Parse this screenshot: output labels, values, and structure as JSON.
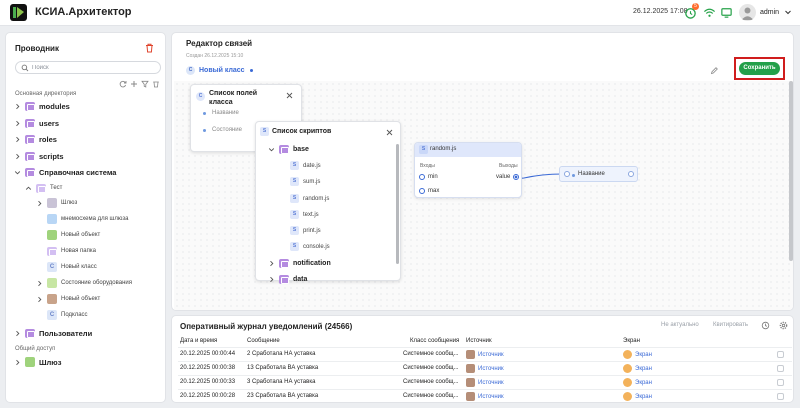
{
  "header": {
    "app_title": "КСИА.Архитектор",
    "datetime": "26.12.2025 17:08",
    "notification_count": "5",
    "username": "admin",
    "colors": {
      "accent": "#4caf50",
      "badge": "#ff6b2c"
    }
  },
  "sidebar": {
    "title": "Проводник",
    "search_placeholder": "Поиск",
    "section_main": "Основная директория",
    "section_shared": "Общий доступ",
    "items": [
      {
        "label": "modules"
      },
      {
        "label": "users"
      },
      {
        "label": "roles"
      },
      {
        "label": "scripts"
      },
      {
        "label": "Справочная система"
      },
      {
        "label": "Тест"
      },
      {
        "label": "Шлюз"
      },
      {
        "label": "мнемосхема для шлюза"
      },
      {
        "label": "Новый объект"
      },
      {
        "label": "Новая папка"
      },
      {
        "label": "Новый класс"
      },
      {
        "label": "Состояние оборудования"
      },
      {
        "label": "Новый объект"
      },
      {
        "label": "Подкласс"
      },
      {
        "label": "Пользователи"
      },
      {
        "label": "Шлюз"
      }
    ]
  },
  "editor": {
    "title": "Редактор связей",
    "created": "Создан 26.12.2025 15:10",
    "class_icon": "С",
    "class_name": "Новый класс",
    "save_label": "Сохранить",
    "fields_card": {
      "title": "Список полей класса",
      "icon": "С",
      "fields": [
        "Название",
        "Состояние"
      ]
    },
    "scripts_card": {
      "title": "Список скриптов",
      "icon": "S",
      "folders": [
        "base",
        "notification",
        "data"
      ],
      "scripts": [
        "date.js",
        "sum.js",
        "random.js",
        "text.js",
        "print.js",
        "console.js"
      ]
    },
    "random_node": {
      "icon": "S",
      "title": "random.js",
      "inputs_label": "Входы",
      "outputs_label": "Выходы",
      "inputs": [
        "min",
        "max"
      ],
      "output": "value"
    },
    "target_node": {
      "label": "Название"
    }
  },
  "journal": {
    "title": "Оперативный журнал уведомлений (24566)",
    "btn_irrelevant": "Не актуально",
    "btn_ack": "Квитировать",
    "columns": [
      "Дата и время",
      "Сообщение",
      "Класс сообщения",
      "Источник",
      "Экран"
    ],
    "rows": [
      {
        "datetime": "20.12.2025 00:00:44",
        "message": "2 Сработала НА уставка",
        "class": "Системное сообщ...",
        "source": "Источник",
        "screen": "Экран"
      },
      {
        "datetime": "20.12.2025 00:00:38",
        "message": "13 Сработала ВА уставка",
        "class": "Системное сообщ...",
        "source": "Источник",
        "screen": "Экран"
      },
      {
        "datetime": "20.12.2025 00:00:33",
        "message": "3 Сработала НА уставка",
        "class": "Системное сообщ...",
        "source": "Источник",
        "screen": "Экран"
      },
      {
        "datetime": "20.12.2025 00:00:28",
        "message": "23 Сработала ВА уставка",
        "class": "Системное сообщ...",
        "source": "Источник",
        "screen": "Экран"
      }
    ]
  }
}
